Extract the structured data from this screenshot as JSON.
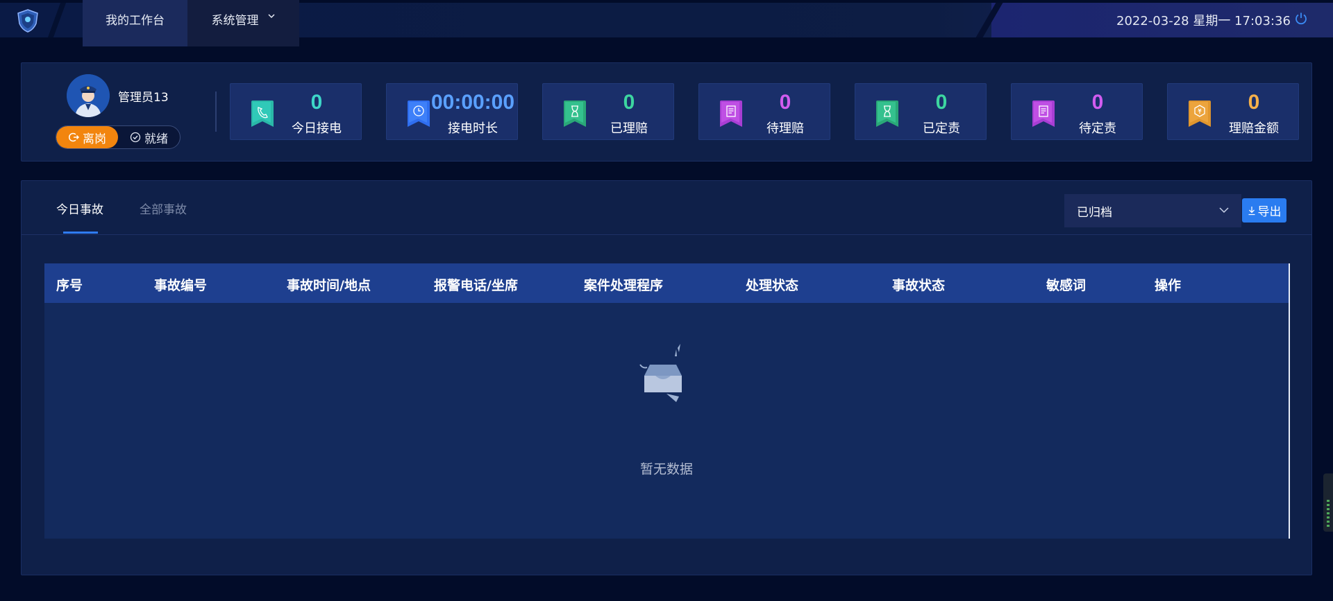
{
  "header": {
    "tabs": [
      {
        "label": "我的工作台",
        "active": true
      },
      {
        "label": "系统管理",
        "active": false
      }
    ],
    "datetime": "2022-03-28 星期一 17:03:36"
  },
  "user": {
    "name": "管理员13",
    "status_leave": "离岗",
    "status_ready": "就绪",
    "active_status": "离岗"
  },
  "stats": [
    {
      "value": "0",
      "label": "今日接电",
      "icon": "phone-icon",
      "color": "#3dd6c8"
    },
    {
      "value": "00:00:00",
      "label": "接电时长",
      "icon": "clock-icon",
      "color": "#5aa0ff"
    },
    {
      "value": "0",
      "label": "已理赔",
      "icon": "hourglass-icon",
      "color": "#3dd6a0"
    },
    {
      "value": "0",
      "label": "待理赔",
      "icon": "document-icon",
      "color": "#d15cf0"
    },
    {
      "value": "0",
      "label": "已定责",
      "icon": "hourglass-icon",
      "color": "#3dd6a0"
    },
    {
      "value": "0",
      "label": "待定责",
      "icon": "document-icon",
      "color": "#d15cf0"
    },
    {
      "value": "0",
      "label": "理赔金额",
      "icon": "money-icon",
      "color": "#f5b04a"
    }
  ],
  "main": {
    "tabs": [
      {
        "label": "今日事故",
        "active": true
      },
      {
        "label": "全部事故",
        "active": false
      }
    ],
    "filter": {
      "selected": "已归档"
    },
    "export_label": "导出",
    "table": {
      "columns": [
        "序号",
        "事故编号",
        "事故时间/地点",
        "报警电话/坐席",
        "案件处理程序",
        "处理状态",
        "事故状态",
        "敏感词",
        "操作"
      ],
      "rows": [],
      "empty_text": "暂无数据"
    }
  }
}
